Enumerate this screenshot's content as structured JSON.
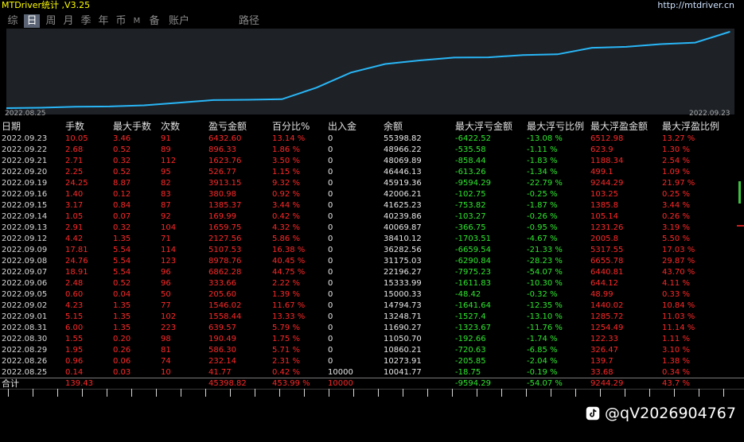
{
  "window": {
    "title": "MTDriver统计 ,V3.25",
    "url": "http://mtdriver.cn"
  },
  "tabs": [
    {
      "label": "综",
      "active": false
    },
    {
      "label": "日",
      "active": true
    },
    {
      "label": "周",
      "active": false
    },
    {
      "label": "月",
      "active": false
    },
    {
      "label": "季",
      "active": false
    },
    {
      "label": "年",
      "active": false
    },
    {
      "label": "币",
      "active": false
    },
    {
      "label": "M",
      "active": false
    },
    {
      "label": "备",
      "active": false
    },
    {
      "label": "账户",
      "active": false
    },
    {
      "label": "路径",
      "active": false
    }
  ],
  "chart_data": {
    "type": "line",
    "x_start_label": "2022.08.25",
    "x_end_label": "2022.09.23",
    "x": [
      "2022.08.25",
      "2022.08.26",
      "2022.08.29",
      "2022.08.30",
      "2022.08.31",
      "2022.09.01",
      "2022.09.02",
      "2022.09.05",
      "2022.09.06",
      "2022.09.07",
      "2022.09.08",
      "2022.09.09",
      "2022.09.12",
      "2022.09.13",
      "2022.09.14",
      "2022.09.15",
      "2022.09.16",
      "2022.09.19",
      "2022.09.20",
      "2022.09.21",
      "2022.09.22",
      "2022.09.23"
    ],
    "series": [
      {
        "values": [
          10041.77,
          10273.91,
          10860.21,
          11050.7,
          11690.27,
          13248.71,
          14794.73,
          15000.33,
          15333.99,
          22196.27,
          31175.03,
          36282.56,
          38410.12,
          40069.87,
          40239.86,
          41625.23,
          42006.21,
          45919.36,
          46446.13,
          48069.89,
          48966.22,
          55398.82
        ],
        "color": "#29b6f6"
      }
    ],
    "grid": false,
    "legend": "none"
  },
  "table": {
    "headers": [
      "日期",
      "手数",
      "最大手数",
      "次数",
      "盈亏金额",
      "百分比%",
      "出入金",
      "余额",
      "最大浮亏金额",
      "最大浮亏比例",
      "最大浮盈金额",
      "最大浮盈比例"
    ],
    "rows": [
      [
        "2022.09.23",
        "10.05",
        "3.46",
        "91",
        "6432.60",
        "13.14 %",
        "0",
        "55398.82",
        "-6422.52",
        "-13.08 %",
        "6512.98",
        "13.27 %"
      ],
      [
        "2022.09.22",
        "2.68",
        "0.52",
        "89",
        "896.33",
        "1.86 %",
        "0",
        "48966.22",
        "-535.58",
        "-1.11 %",
        "623.9",
        "1.30 %"
      ],
      [
        "2022.09.21",
        "2.71",
        "0.32",
        "112",
        "1623.76",
        "3.50 %",
        "0",
        "48069.89",
        "-858.44",
        "-1.83 %",
        "1188.34",
        "2.54 %"
      ],
      [
        "2022.09.20",
        "2.25",
        "0.52",
        "95",
        "526.77",
        "1.15 %",
        "0",
        "46446.13",
        "-613.26",
        "-1.34 %",
        "499.1",
        "1.09 %"
      ],
      [
        "2022.09.19",
        "24.25",
        "8.87",
        "82",
        "3913.15",
        "9.32 %",
        "0",
        "45919.36",
        "-9594.29",
        "-22.79 %",
        "9244.29",
        "21.97 %"
      ],
      [
        "2022.09.16",
        "1.40",
        "0.12",
        "83",
        "380.98",
        "0.92 %",
        "0",
        "42006.21",
        "-102.75",
        "-0.25 %",
        "103.25",
        "0.25 %"
      ],
      [
        "2022.09.15",
        "3.17",
        "0.84",
        "87",
        "1385.37",
        "3.44 %",
        "0",
        "41625.23",
        "-753.82",
        "-1.87 %",
        "1385.8",
        "3.44 %"
      ],
      [
        "2022.09.14",
        "1.05",
        "0.07",
        "92",
        "169.99",
        "0.42 %",
        "0",
        "40239.86",
        "-103.27",
        "-0.26 %",
        "105.14",
        "0.26 %"
      ],
      [
        "2022.09.13",
        "2.91",
        "0.32",
        "104",
        "1659.75",
        "4.32 %",
        "0",
        "40069.87",
        "-366.75",
        "-0.95 %",
        "1231.26",
        "3.19 %"
      ],
      [
        "2022.09.12",
        "4.42",
        "1.35",
        "71",
        "2127.56",
        "5.86 %",
        "0",
        "38410.12",
        "-1703.51",
        "-4.67 %",
        "2005.8",
        "5.50 %"
      ],
      [
        "2022.09.09",
        "17.81",
        "5.54",
        "114",
        "5107.53",
        "16.38 %",
        "0",
        "36282.56",
        "-6659.54",
        "-21.33 %",
        "5317.55",
        "17.03 %"
      ],
      [
        "2022.09.08",
        "24.76",
        "5.54",
        "123",
        "8978.76",
        "40.45 %",
        "0",
        "31175.03",
        "-6290.84",
        "-28.23 %",
        "6655.78",
        "29.87 %"
      ],
      [
        "2022.09.07",
        "18.91",
        "5.54",
        "96",
        "6862.28",
        "44.75 %",
        "0",
        "22196.27",
        "-7975.23",
        "-54.07 %",
        "6440.81",
        "43.70 %"
      ],
      [
        "2022.09.06",
        "2.48",
        "0.52",
        "96",
        "333.66",
        "2.22 %",
        "0",
        "15333.99",
        "-1611.83",
        "-10.30 %",
        "644.12",
        "4.11 %"
      ],
      [
        "2022.09.05",
        "0.60",
        "0.04",
        "50",
        "205.60",
        "1.39 %",
        "0",
        "15000.33",
        "-48.42",
        "-0.32 %",
        "48.99",
        "0.33 %"
      ],
      [
        "2022.09.02",
        "4.23",
        "1.35",
        "77",
        "1546.02",
        "11.67 %",
        "0",
        "14794.73",
        "-1641.64",
        "-12.35 %",
        "1440.02",
        "10.84 %"
      ],
      [
        "2022.09.01",
        "5.15",
        "1.35",
        "102",
        "1558.44",
        "13.33 %",
        "0",
        "13248.71",
        "-1527.4",
        "-13.10 %",
        "1285.72",
        "11.03 %"
      ],
      [
        "2022.08.31",
        "6.00",
        "1.35",
        "223",
        "639.57",
        "5.79 %",
        "0",
        "11690.27",
        "-1323.67",
        "-11.76 %",
        "1254.49",
        "11.14 %"
      ],
      [
        "2022.08.30",
        "1.55",
        "0.20",
        "98",
        "190.49",
        "1.75 %",
        "0",
        "11050.70",
        "-192.66",
        "-1.74 %",
        "122.33",
        "1.11 %"
      ],
      [
        "2022.08.29",
        "1.95",
        "0.26",
        "81",
        "586.30",
        "5.71 %",
        "0",
        "10860.21",
        "-720.63",
        "-6.85 %",
        "326.47",
        "3.10 %"
      ],
      [
        "2022.08.26",
        "0.96",
        "0.06",
        "74",
        "232.14",
        "2.31 %",
        "0",
        "10273.91",
        "-205.85",
        "-2.04 %",
        "139.7",
        "1.38 %"
      ],
      [
        "2022.08.25",
        "0.14",
        "0.03",
        "10",
        "41.77",
        "0.42 %",
        "10000",
        "10041.77",
        "-18.75",
        "-0.19 %",
        "33.68",
        "0.34 %"
      ]
    ],
    "total": {
      "label": "合计",
      "lots": "139.43",
      "pnl": "45398.82",
      "pct": "453.99 %",
      "inout": "10000",
      "max_dd": "-9594.29",
      "max_dd_pct": "-54.07 %",
      "max_gain": "9244.29",
      "max_gain_pct": "43.7 %"
    }
  },
  "watermark": {
    "text": "@qV2026904767",
    "icon": "douyin-icon"
  }
}
